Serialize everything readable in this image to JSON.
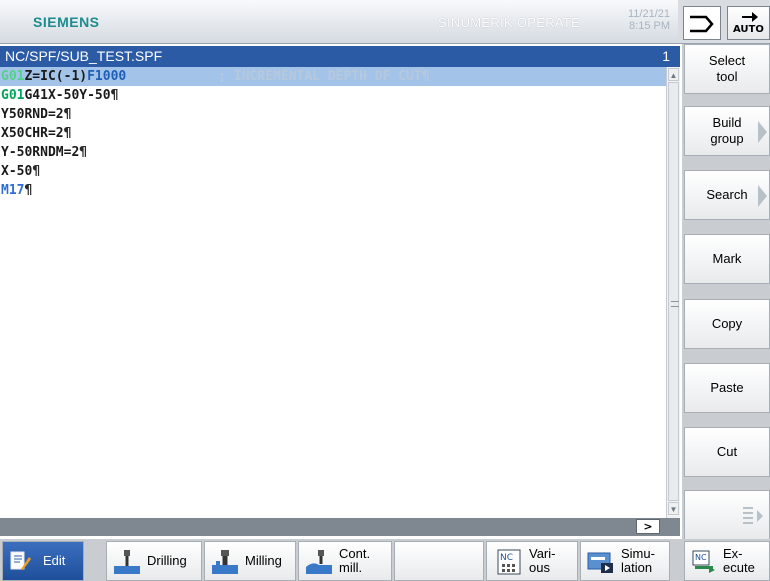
{
  "header": {
    "brand": "SIEMENS",
    "product": "SINUMERIK OPERATE",
    "date": "11/21/21",
    "time": "8:15 PM",
    "mode_label": "AUTO"
  },
  "pathbar": {
    "path": "NC/SPF/SUB_TEST.SPF",
    "channel": "1"
  },
  "editor": {
    "lines": [
      {
        "parts": [
          "G01",
          "Z=IC(-1)",
          "F1000",
          "; INCREMENTAL DEPTH OF CUT",
          "¶"
        ]
      },
      {
        "parts": [
          "G01",
          "G41X-50Y-50",
          "¶"
        ]
      },
      {
        "text": "Y50RND=2",
        "pil": "¶"
      },
      {
        "text": "X50CHR=2",
        "pil": "¶"
      },
      {
        "text": "Y-50RNDM=2",
        "pil": "¶"
      },
      {
        "text": "X-50",
        "pil": "¶"
      },
      {
        "text": "M17",
        "pil": "¶"
      }
    ]
  },
  "softkeys_vertical": [
    {
      "label": "Select tool"
    },
    {
      "label": "Build group"
    },
    {
      "label": "Search"
    },
    {
      "label": "Mark"
    },
    {
      "label": "Copy"
    },
    {
      "label": "Paste"
    },
    {
      "label": "Cut"
    },
    {
      "label": ""
    }
  ],
  "softkeys_horizontal": [
    {
      "label": "Edit",
      "active": true
    },
    {
      "label": "Drilling"
    },
    {
      "label": "Milling"
    },
    {
      "label": "Cont. mill."
    },
    {
      "label": ""
    },
    {
      "label": "Vari- ous"
    },
    {
      "label": "Simu- lation"
    },
    {
      "label": "Ex- ecute"
    }
  ],
  "colors": {
    "accent": "#2b5ba5",
    "highlight": "#a4c3e8",
    "gcode_green": "#00a35a",
    "feed_blue": "#1f5fb6",
    "brand_teal": "#1c8c8e"
  }
}
